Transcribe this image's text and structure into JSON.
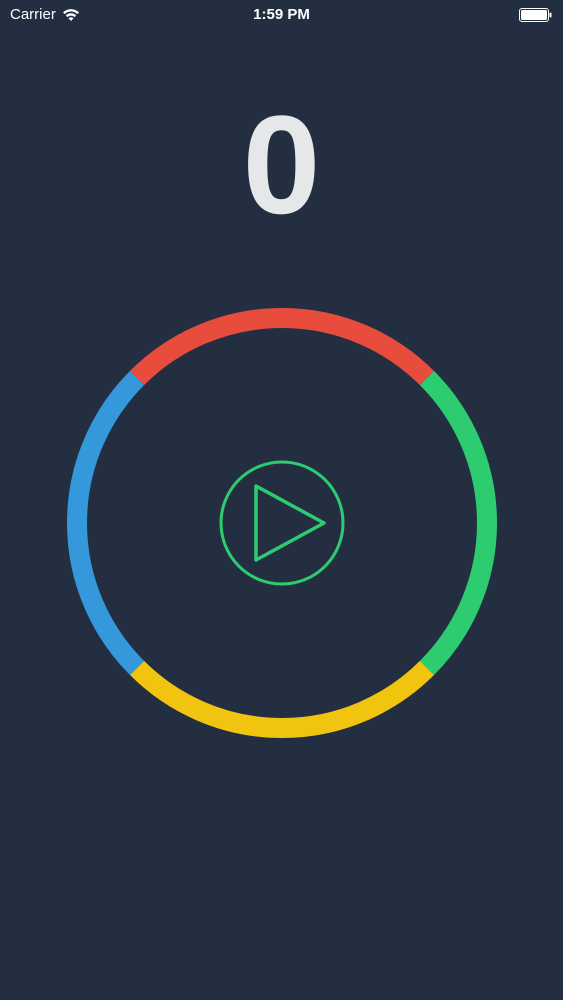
{
  "status_bar": {
    "carrier": "Carrier",
    "time": "1:59 PM",
    "wifi_icon": "wifi-icon",
    "battery_icon": "battery-icon"
  },
  "game": {
    "score": "0",
    "ring_segments": [
      {
        "name": "red",
        "color": "#e74c3c"
      },
      {
        "name": "green",
        "color": "#2ecc71"
      },
      {
        "name": "yellow",
        "color": "#f1c40f"
      },
      {
        "name": "blue",
        "color": "#3498db"
      }
    ],
    "play_icon": "play-icon",
    "play_color": "#2ecc71"
  },
  "colors": {
    "background": "#232f41",
    "score_text": "#e6e7e9"
  }
}
